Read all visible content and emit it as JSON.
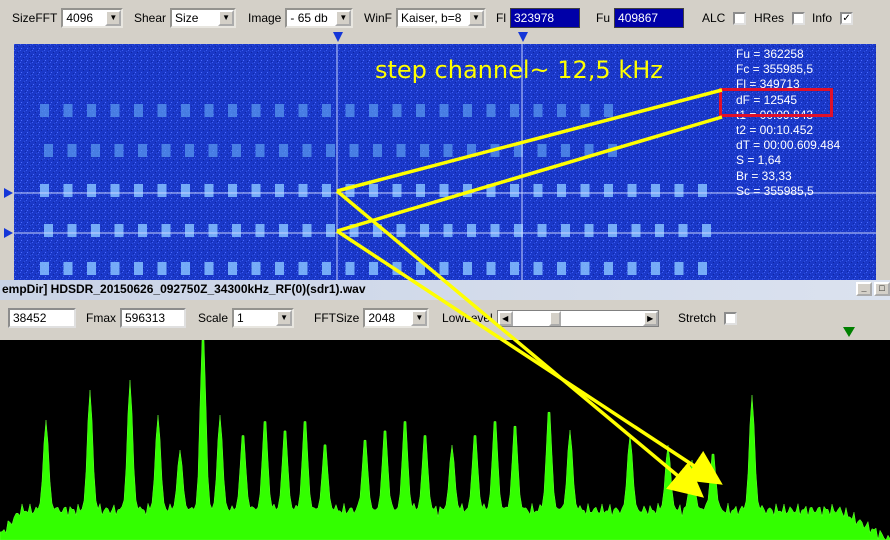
{
  "toolbar_top": {
    "sizefft_label": "SizeFFT",
    "sizefft_value": "4096",
    "shear_label": "Shear",
    "shear_value": "Size",
    "image_label": "Image",
    "image_value": "- 65 db",
    "winf_label": "WinF",
    "winf_value": "Kaiser, b=8",
    "fl_label": "Fl",
    "fl_value": "323978",
    "fu_label": "Fu",
    "fu_value": "409867",
    "alc_label": "ALC",
    "alc_checked": false,
    "hres_label": "HRes",
    "hres_checked": false,
    "info_label": "Info",
    "info_checked": true
  },
  "waterfall": {
    "annotation": "step channel~ 12,5 kHz",
    "info_lines": [
      "Fu = 362258",
      "Fc = 355985,5",
      "Fl = 349713",
      "dF = 12545",
      "t1 = 00:09.843",
      "t2 = 00:10.452",
      "dT = 00:00.609.484",
      "S = 1,64",
      "Br = 33,33",
      "Sc = 355985,5"
    ]
  },
  "window2": {
    "title": "empDir] HDSDR_20150626_092750Z_34300kHz_RF(0)(sdr1).wav",
    "min_glyph": "_",
    "max_glyph": "□"
  },
  "toolbar_bottom": {
    "fmin_value": "38452",
    "fmax_label": "Fmax",
    "fmax_value": "596313",
    "scale_label": "Scale",
    "scale_value": "1",
    "fftsize_label": "FFTSize",
    "fftsize_value": "2048",
    "lowlevel_label": "LowLevel",
    "lowlevel_position": 0.3,
    "stretch_label": "Stretch",
    "stretch_checked": false
  },
  "colors": {
    "waterfall_bg": "#1836c8",
    "spectrum_fill": "#33ff00",
    "annotation": "#ffff00",
    "highlight": "#e0102a"
  }
}
